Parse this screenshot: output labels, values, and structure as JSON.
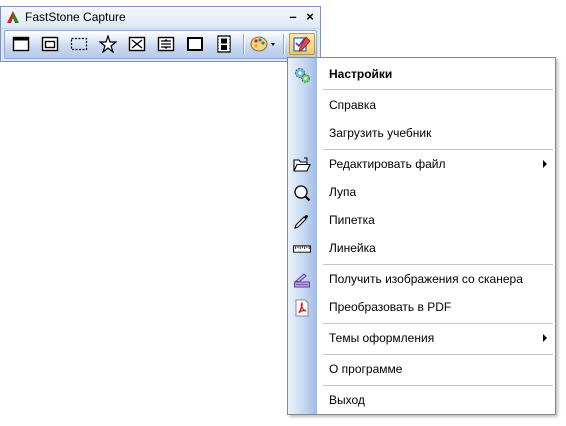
{
  "window": {
    "title": "FastStone Capture",
    "minimize_label": "–",
    "close_label": "×"
  },
  "toolbar": {
    "tools": [
      {
        "icon": "capture-window-icon"
      },
      {
        "icon": "capture-object-icon"
      },
      {
        "icon": "capture-rectangle-icon"
      },
      {
        "icon": "capture-freehand-icon"
      },
      {
        "icon": "capture-fullscreen-icon"
      },
      {
        "icon": "capture-scrolling-icon"
      },
      {
        "icon": "capture-fixed-region-icon"
      },
      {
        "icon": "screen-recorder-icon"
      },
      {
        "icon": "output-palette-icon"
      },
      {
        "icon": "settings-menu-icon"
      }
    ]
  },
  "menu": {
    "items": [
      {
        "label": "Настройки",
        "icon": "gears-icon",
        "bold": true
      },
      {
        "label": "Справка"
      },
      {
        "label": "Загрузить учебник"
      },
      {
        "label": "Редактировать файл",
        "icon": "open-folder-icon",
        "submenu": true
      },
      {
        "label": "Лупа",
        "icon": "magnifier-icon"
      },
      {
        "label": "Пипетка",
        "icon": "eyedropper-icon"
      },
      {
        "label": "Линейка",
        "icon": "ruler-icon"
      },
      {
        "label": "Получить изображения со сканера",
        "icon": "scanner-icon"
      },
      {
        "label": "Преобразовать в PDF",
        "icon": "pdf-icon"
      },
      {
        "label": "Темы оформления",
        "submenu": true
      },
      {
        "label": "О программе"
      },
      {
        "label": "Выход"
      }
    ]
  },
  "colors": {
    "accent": "#3c6fc4",
    "hover": "#f6c866"
  }
}
